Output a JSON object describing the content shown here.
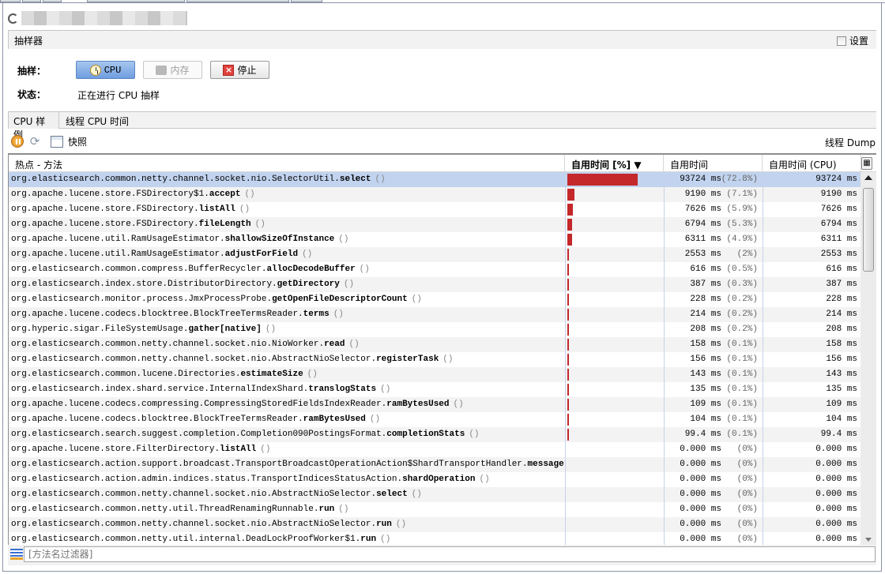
{
  "window": {
    "title_obscured": true
  },
  "sampler": {
    "section_title": "抽样器",
    "settings_label": "设置",
    "settings_checked": false,
    "sampling_label": "抽样：",
    "buttons": {
      "cpu": "CPU",
      "memory": "内存",
      "stop": "停止"
    },
    "status_label": "状态：",
    "status_value": "正在进行 CPU 抽样"
  },
  "subtabs": [
    {
      "label": "CPU 样例",
      "selected": true
    },
    {
      "label": "线程 CPU 时间",
      "selected": false
    }
  ],
  "toolbar": {
    "snapshot_label": "快照",
    "thread_dump_label": "线程 Dump"
  },
  "table": {
    "columns": [
      "热点 - 方法",
      "自用时间 [%] ▼",
      "自用时间",
      "自用时间 (CPU)"
    ],
    "rows": [
      {
        "pkg": "org.elasticsearch.common.netty.channel.socket.nio.SelectorUtil.",
        "method": "select",
        "self_time": "93724 ms",
        "pct": "(72.8%)",
        "pct_value": 72.8,
        "cpu": "93724 ms",
        "selected": true
      },
      {
        "pkg": "org.apache.lucene.store.FSDirectory$1.",
        "method": "accept",
        "self_time": "9190 ms",
        "pct": "(7.1%)",
        "pct_value": 7.1,
        "cpu": "9190 ms"
      },
      {
        "pkg": "org.apache.lucene.store.FSDirectory.",
        "method": "listAll",
        "self_time": "7626 ms",
        "pct": "(5.9%)",
        "pct_value": 5.9,
        "cpu": "7626 ms"
      },
      {
        "pkg": "org.apache.lucene.store.FSDirectory.",
        "method": "fileLength",
        "self_time": "6794 ms",
        "pct": "(5.3%)",
        "pct_value": 5.3,
        "cpu": "6794 ms"
      },
      {
        "pkg": "org.apache.lucene.util.RamUsageEstimator.",
        "method": "shallowSizeOfInstance",
        "self_time": "6311 ms",
        "pct": "(4.9%)",
        "pct_value": 4.9,
        "cpu": "6311 ms"
      },
      {
        "pkg": "org.apache.lucene.util.RamUsageEstimator.",
        "method": "adjustForField",
        "self_time": "2553 ms",
        "pct": "(2%)",
        "pct_value": 2,
        "cpu": "2553 ms"
      },
      {
        "pkg": "org.elasticsearch.common.compress.BufferRecycler.",
        "method": "allocDecodeBuffer",
        "self_time": "616 ms",
        "pct": "(0.5%)",
        "pct_value": 0.5,
        "cpu": "616 ms"
      },
      {
        "pkg": "org.elasticsearch.index.store.DistributorDirectory.",
        "method": "getDirectory",
        "self_time": "387 ms",
        "pct": "(0.3%)",
        "pct_value": 0.3,
        "cpu": "387 ms"
      },
      {
        "pkg": "org.elasticsearch.monitor.process.JmxProcessProbe.",
        "method": "getOpenFileDescriptorCount",
        "self_time": "228 ms",
        "pct": "(0.2%)",
        "pct_value": 0.2,
        "cpu": "228 ms"
      },
      {
        "pkg": "org.apache.lucene.codecs.blocktree.BlockTreeTermsReader.",
        "method": "terms",
        "self_time": "214 ms",
        "pct": "(0.2%)",
        "pct_value": 0.2,
        "cpu": "214 ms"
      },
      {
        "pkg": "org.hyperic.sigar.FileSystemUsage.",
        "method": "gather[native]",
        "self_time": "208 ms",
        "pct": "(0.2%)",
        "pct_value": 0.2,
        "cpu": "208 ms"
      },
      {
        "pkg": "org.elasticsearch.common.netty.channel.socket.nio.NioWorker.",
        "method": "read",
        "self_time": "158 ms",
        "pct": "(0.1%)",
        "pct_value": 0.1,
        "cpu": "158 ms"
      },
      {
        "pkg": "org.elasticsearch.common.netty.channel.socket.nio.AbstractNioSelector.",
        "method": "registerTask",
        "self_time": "156 ms",
        "pct": "(0.1%)",
        "pct_value": 0.1,
        "cpu": "156 ms"
      },
      {
        "pkg": "org.elasticsearch.common.lucene.Directories.",
        "method": "estimateSize",
        "self_time": "143 ms",
        "pct": "(0.1%)",
        "pct_value": 0.1,
        "cpu": "143 ms"
      },
      {
        "pkg": "org.elasticsearch.index.shard.service.InternalIndexShard.",
        "method": "translogStats",
        "self_time": "135 ms",
        "pct": "(0.1%)",
        "pct_value": 0.1,
        "cpu": "135 ms"
      },
      {
        "pkg": "org.apache.lucene.codecs.compressing.CompressingStoredFieldsIndexReader.",
        "method": "ramBytesUsed",
        "self_time": "109 ms",
        "pct": "(0.1%)",
        "pct_value": 0.1,
        "cpu": "109 ms"
      },
      {
        "pkg": "org.apache.lucene.codecs.blocktree.BlockTreeTermsReader.",
        "method": "ramBytesUsed",
        "self_time": "104 ms",
        "pct": "(0.1%)",
        "pct_value": 0.1,
        "cpu": "104 ms"
      },
      {
        "pkg": "org.elasticsearch.search.suggest.completion.Completion090PostingsFormat.",
        "method": "completionStats",
        "self_time": "99.4 ms",
        "pct": "(0.1%)",
        "pct_value": 0.1,
        "cpu": "99.4 ms"
      },
      {
        "pkg": "org.apache.lucene.store.FilterDirectory.",
        "method": "listAll",
        "self_time": "0.000 ms",
        "pct": "(0%)",
        "pct_value": 0,
        "cpu": "0.000 ms"
      },
      {
        "pkg": "org.elasticsearch.action.support.broadcast.TransportBroadcastOperationAction$ShardTransportHandler.",
        "method": "messageReceived",
        "self_time": "0.000 ms",
        "pct": "(0%)",
        "pct_value": 0,
        "cpu": "0.000 ms",
        "no_parens": true
      },
      {
        "pkg": "org.elasticsearch.action.admin.indices.status.TransportIndicesStatusAction.",
        "method": "shardOperation",
        "self_time": "0.000 ms",
        "pct": "(0%)",
        "pct_value": 0,
        "cpu": "0.000 ms"
      },
      {
        "pkg": "org.elasticsearch.common.netty.channel.socket.nio.AbstractNioSelector.",
        "method": "select",
        "self_time": "0.000 ms",
        "pct": "(0%)",
        "pct_value": 0,
        "cpu": "0.000 ms"
      },
      {
        "pkg": "org.elasticsearch.common.netty.util.ThreadRenamingRunnable.",
        "method": "run",
        "self_time": "0.000 ms",
        "pct": "(0%)",
        "pct_value": 0,
        "cpu": "0.000 ms"
      },
      {
        "pkg": "org.elasticsearch.common.netty.channel.socket.nio.AbstractNioSelector.",
        "method": "run",
        "self_time": "0.000 ms",
        "pct": "(0%)",
        "pct_value": 0,
        "cpu": "0.000 ms"
      },
      {
        "pkg": "org.elasticsearch.common.netty.util.internal.DeadLockProofWorker$1.",
        "method": "run",
        "self_time": "0.000 ms",
        "pct": "(0%)",
        "pct_value": 0,
        "cpu": "0.000 ms"
      }
    ],
    "parens": "()"
  },
  "filter": {
    "placeholder": "[方法名过滤器]"
  },
  "colors": {
    "bar": "#c4282b",
    "selected_row": "#c1d3ee",
    "active_button": "#6f9ee0"
  }
}
